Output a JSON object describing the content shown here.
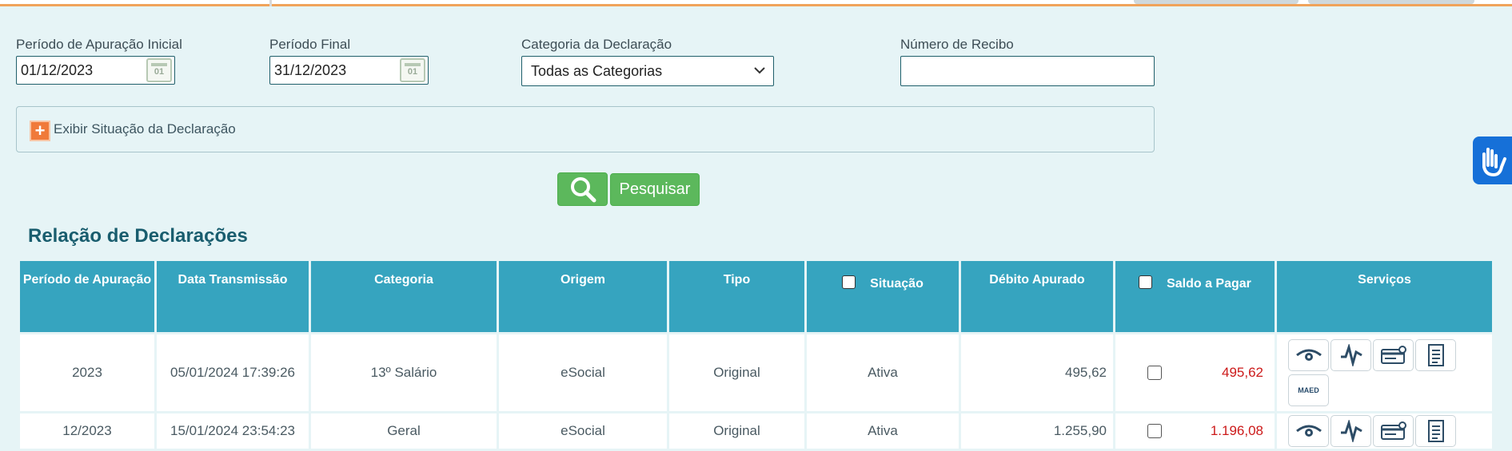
{
  "filters": {
    "periodo_inicial_label": "Período de Apuração Inicial",
    "periodo_inicial_value": "01/12/2023",
    "periodo_final_label": "Período Final",
    "periodo_final_value": "31/12/2023",
    "calendar_icon_text": "01",
    "categoria_label": "Categoria da Declaração",
    "categoria_value": "Todas as Categorias",
    "recibo_label": "Número de Recibo",
    "recibo_value": ""
  },
  "toggle": {
    "label": "Exibir Situação da Declaração",
    "icon": "plus-icon"
  },
  "search": {
    "button_label": "Pesquisar",
    "icon": "search-icon"
  },
  "section_title": "Relação de Declarações",
  "table": {
    "headers": {
      "periodo": "Período de Apuração",
      "data": "Data Transmissão",
      "categoria": "Categoria",
      "origem": "Origem",
      "tipo": "Tipo",
      "situacao": "Situação",
      "debito": "Débito Apurado",
      "saldo": "Saldo a Pagar",
      "servicos": "Serviços"
    },
    "rows": [
      {
        "periodo": "2023",
        "data": "05/01/2024 17:39:26",
        "categoria": "13º Salário",
        "origem": "eSocial",
        "tipo": "Original",
        "situacao": "Ativa",
        "debito": "495,62",
        "saldo": "495,62",
        "maed": "MAED"
      },
      {
        "periodo": "12/2023",
        "data": "15/01/2024 23:54:23",
        "categoria": "Geral",
        "origem": "eSocial",
        "tipo": "Original",
        "situacao": "Ativa",
        "debito": "1.255,90",
        "saldo": "1.196,08"
      }
    ]
  },
  "colors": {
    "header_bg": "#36a4bf",
    "accent_green": "#5cb85c",
    "saldo_red": "#cc1a1a",
    "title": "#195d6e",
    "page_bg": "#e6f4f6"
  }
}
